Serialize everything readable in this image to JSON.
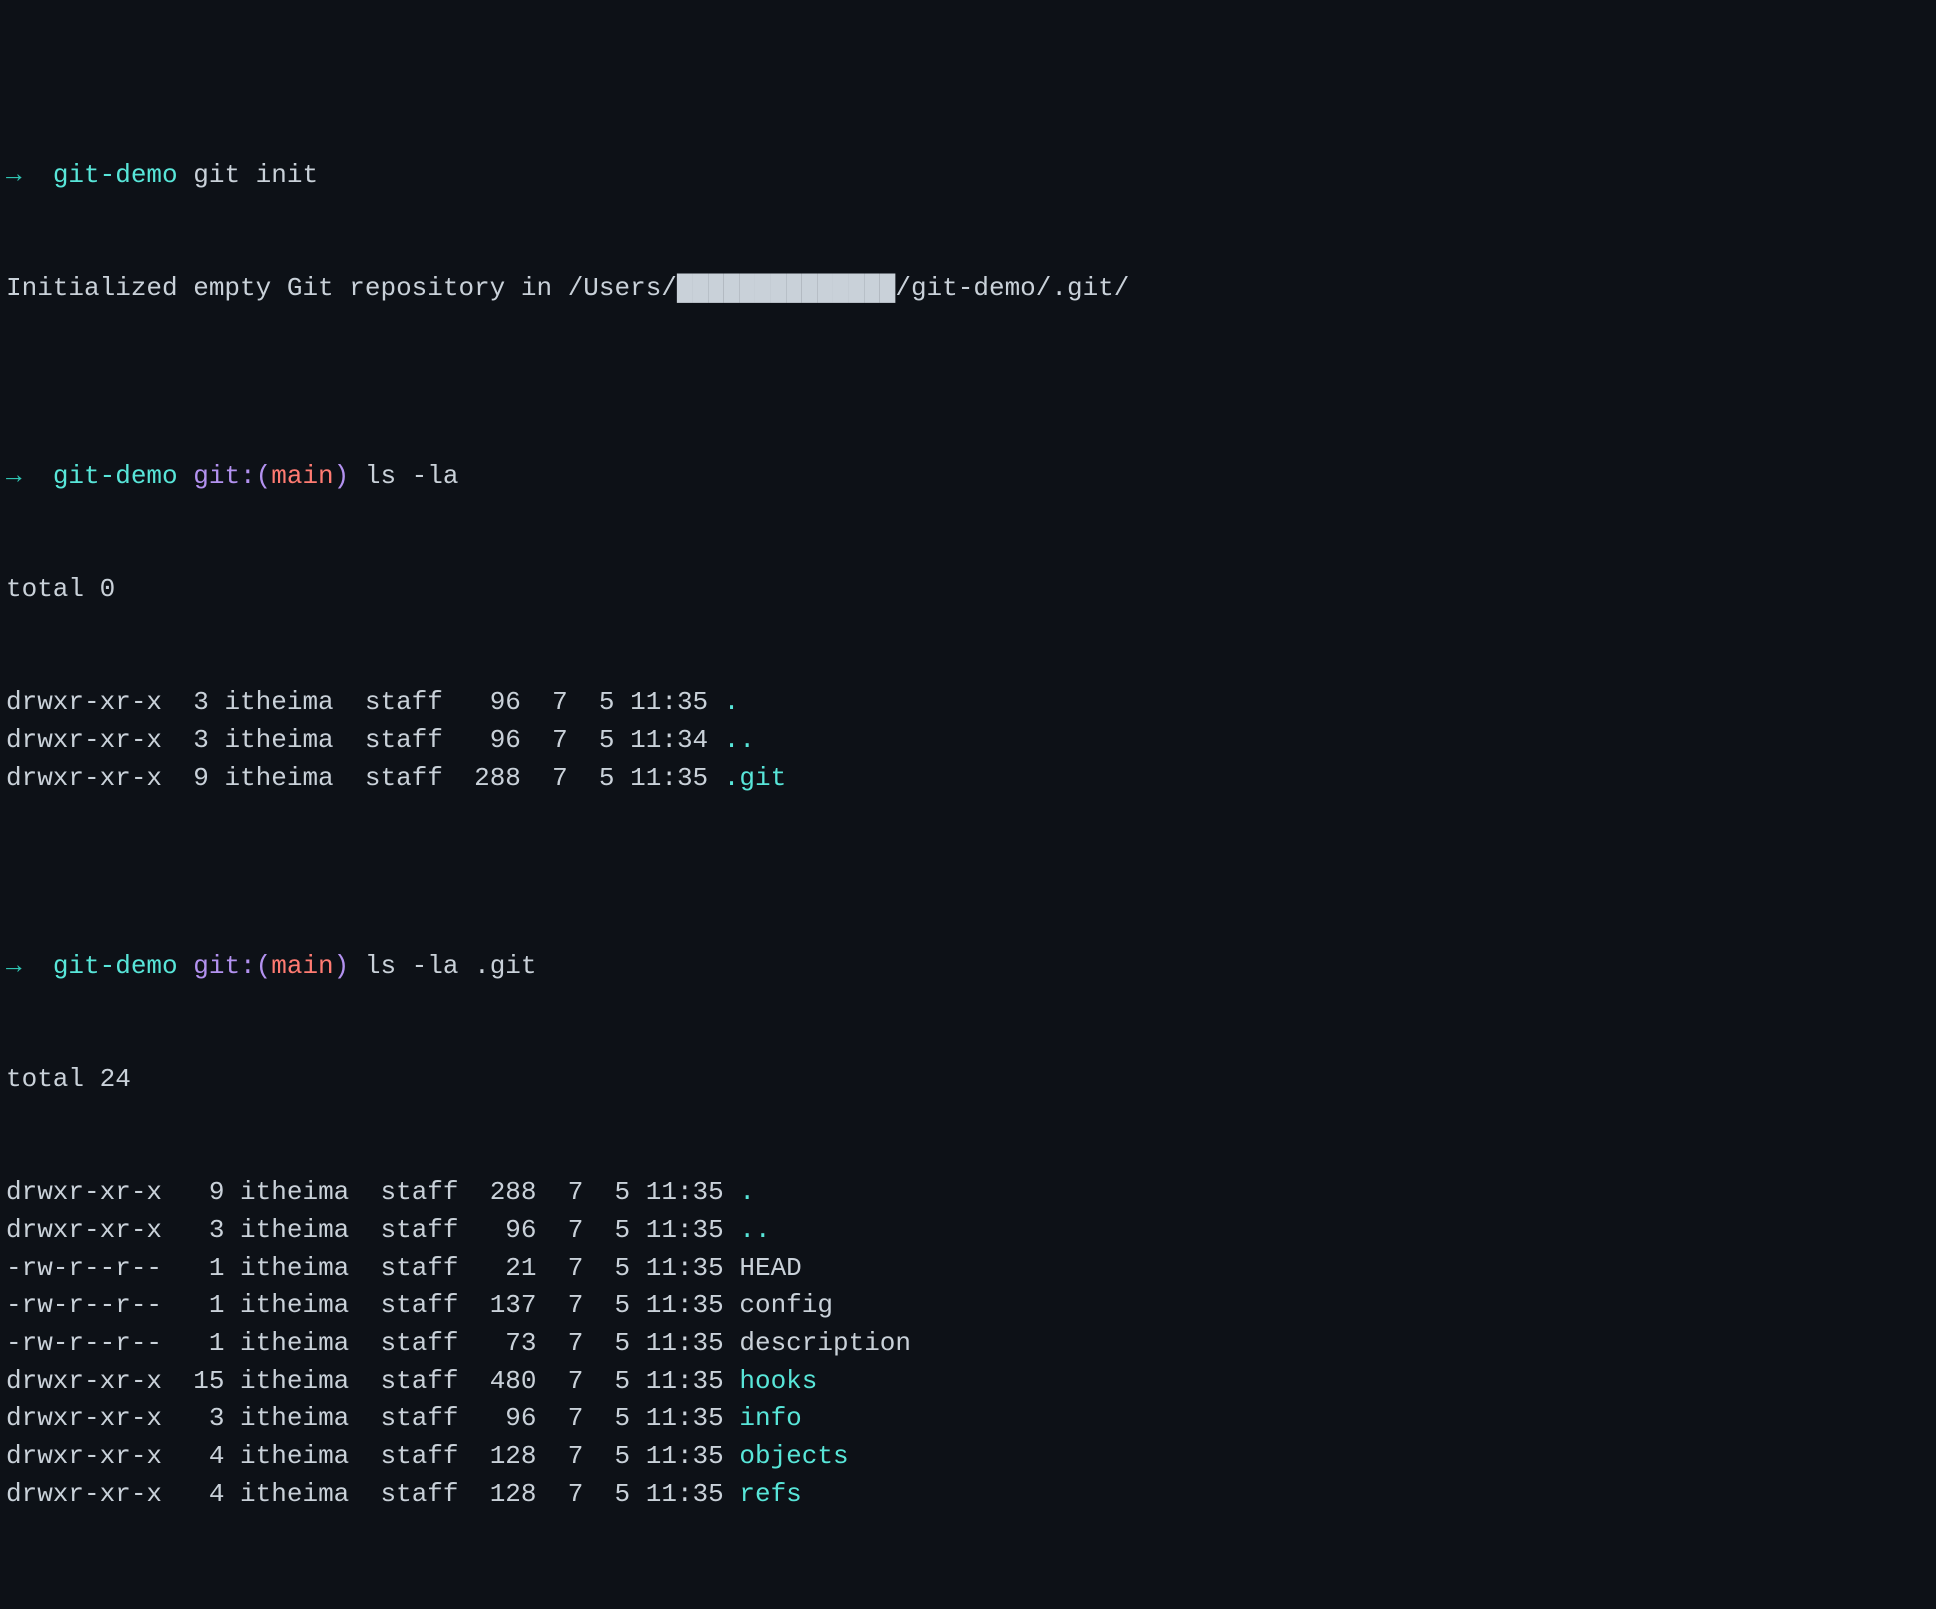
{
  "prompt_arrow": "→",
  "blocks": [
    {
      "prompt": {
        "dir": "git-demo",
        "git": null,
        "command": "git init"
      },
      "output_lines": [
        {
          "text": "Initialized empty Git repository in /Users/██████████████/git-demo/.git/"
        }
      ]
    },
    {
      "prompt": {
        "dir": "git-demo",
        "git": {
          "label_left": "git:(",
          "branch": "main",
          "label_right": ")"
        },
        "command": "ls -la"
      },
      "total": "total 0",
      "listing": [
        {
          "perm": "drwxr-xr-x",
          "links": "3",
          "user": "itheima",
          "group": "staff",
          "size": "96",
          "mon": "7",
          "day": "5",
          "time": "11:35",
          "name": ".",
          "dir": true
        },
        {
          "perm": "drwxr-xr-x",
          "links": "3",
          "user": "itheima",
          "group": "staff",
          "size": "96",
          "mon": "7",
          "day": "5",
          "time": "11:34",
          "name": "..",
          "dir": true
        },
        {
          "perm": "drwxr-xr-x",
          "links": "9",
          "user": "itheima",
          "group": "staff",
          "size": "288",
          "mon": "7",
          "day": "5",
          "time": "11:35",
          "name": ".git",
          "dir": true
        }
      ]
    },
    {
      "prompt": {
        "dir": "git-demo",
        "git": {
          "label_left": "git:(",
          "branch": "main",
          "label_right": ")"
        },
        "command": "ls -la .git"
      },
      "total": "total 24",
      "listing": [
        {
          "perm": "drwxr-xr-x",
          "links": "9",
          "user": "itheima",
          "group": "staff",
          "size": "288",
          "mon": "7",
          "day": "5",
          "time": "11:35",
          "name": ".",
          "dir": true
        },
        {
          "perm": "drwxr-xr-x",
          "links": "3",
          "user": "itheima",
          "group": "staff",
          "size": "96",
          "mon": "7",
          "day": "5",
          "time": "11:35",
          "name": "..",
          "dir": true
        },
        {
          "perm": "-rw-r--r--",
          "links": "1",
          "user": "itheima",
          "group": "staff",
          "size": "21",
          "mon": "7",
          "day": "5",
          "time": "11:35",
          "name": "HEAD",
          "dir": false
        },
        {
          "perm": "-rw-r--r--",
          "links": "1",
          "user": "itheima",
          "group": "staff",
          "size": "137",
          "mon": "7",
          "day": "5",
          "time": "11:35",
          "name": "config",
          "dir": false
        },
        {
          "perm": "-rw-r--r--",
          "links": "1",
          "user": "itheima",
          "group": "staff",
          "size": "73",
          "mon": "7",
          "day": "5",
          "time": "11:35",
          "name": "description",
          "dir": false
        },
        {
          "perm": "drwxr-xr-x",
          "links": "15",
          "user": "itheima",
          "group": "staff",
          "size": "480",
          "mon": "7",
          "day": "5",
          "time": "11:35",
          "name": "hooks",
          "dir": true
        },
        {
          "perm": "drwxr-xr-x",
          "links": "3",
          "user": "itheima",
          "group": "staff",
          "size": "96",
          "mon": "7",
          "day": "5",
          "time": "11:35",
          "name": "info",
          "dir": true
        },
        {
          "perm": "drwxr-xr-x",
          "links": "4",
          "user": "itheima",
          "group": "staff",
          "size": "128",
          "mon": "7",
          "day": "5",
          "time": "11:35",
          "name": "objects",
          "dir": true
        },
        {
          "perm": "drwxr-xr-x",
          "links": "4",
          "user": "itheima",
          "group": "staff",
          "size": "128",
          "mon": "7",
          "day": "5",
          "time": "11:35",
          "name": "refs",
          "dir": true
        }
      ]
    }
  ]
}
